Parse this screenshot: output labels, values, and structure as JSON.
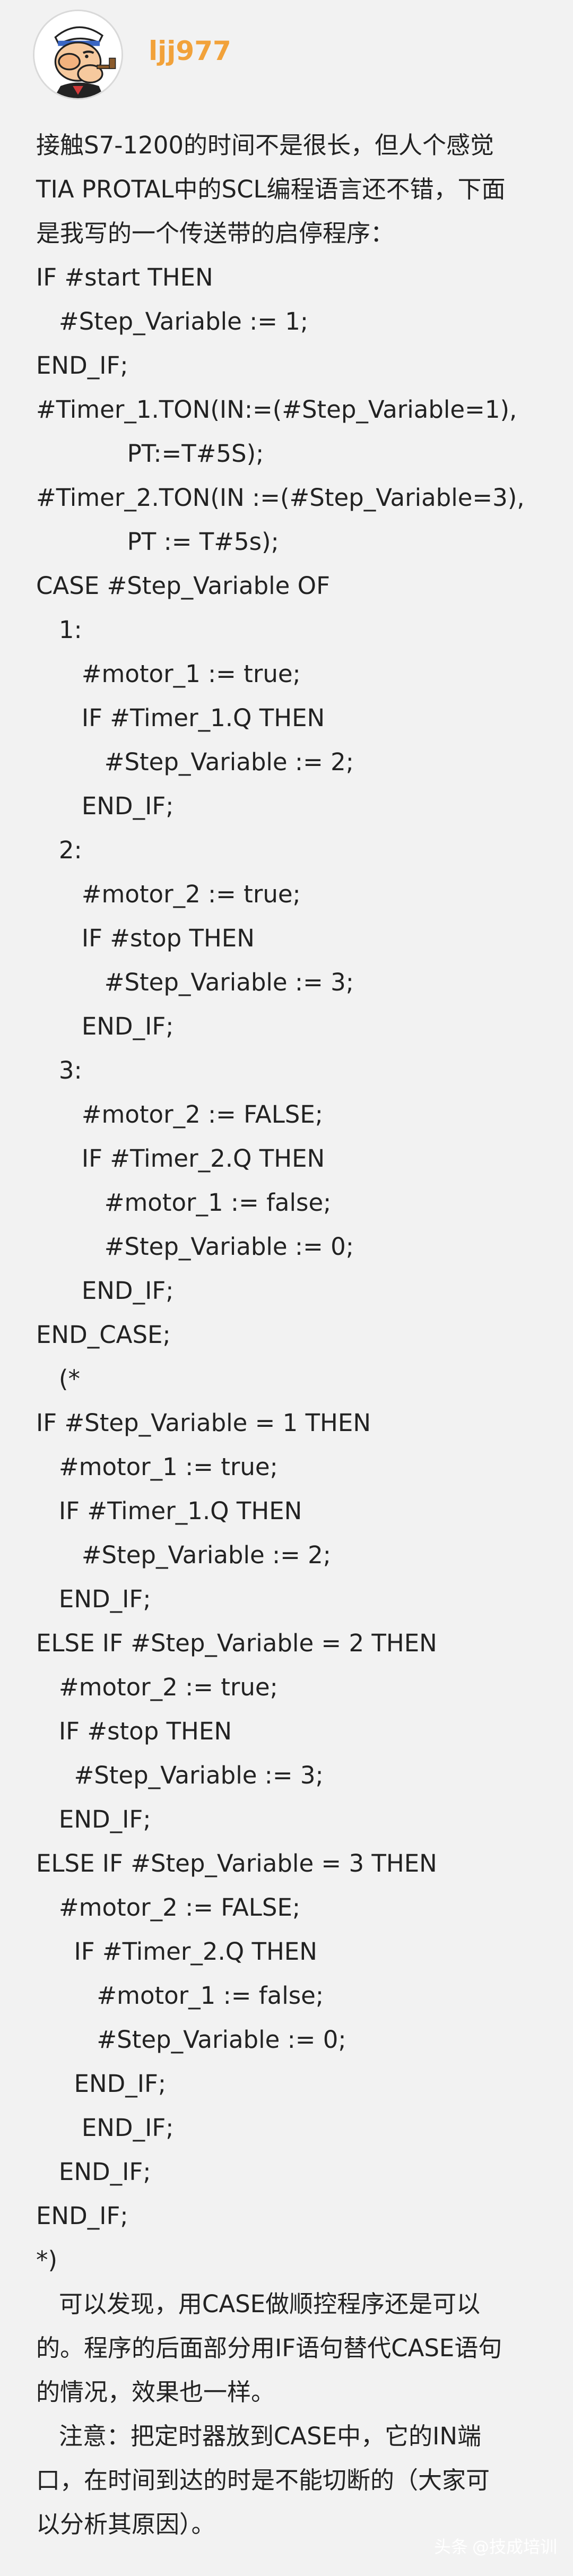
{
  "author": {
    "username": "ljj977",
    "avatar_icon": "popeye-avatar-icon"
  },
  "colors": {
    "background": "#f2f2f2",
    "username": "#f2a23a",
    "text": "#222222"
  },
  "content": {
    "lines": [
      "接触S7-1200的时间不是很长，但人个感觉",
      "TIA PROTAL中的SCL编程语言还不错，下面",
      "是我写的一个传送带的启停程序：",
      "IF #start THEN",
      "   #Step_Variable := 1;",
      "END_IF;",
      "#Timer_1.TON(IN:=(#Step_Variable=1),",
      "            PT:=T#5S);",
      "#Timer_2.TON(IN :=(#Step_Variable=3),",
      "            PT := T#5s);",
      "CASE #Step_Variable OF",
      "   1:",
      "      #motor_1 := true;",
      "      IF #Timer_1.Q THEN",
      "         #Step_Variable := 2;",
      "      END_IF;",
      "   2:",
      "      #motor_2 := true;",
      "      IF #stop THEN",
      "         #Step_Variable := 3;",
      "      END_IF;",
      "   3:",
      "      #motor_2 := FALSE;",
      "      IF #Timer_2.Q THEN",
      "         #motor_1 := false;",
      "         #Step_Variable := 0;",
      "      END_IF;",
      "END_CASE;",
      "   (*",
      "IF #Step_Variable = 1 THEN",
      "   #motor_1 := true;",
      "   IF #Timer_1.Q THEN",
      "      #Step_Variable := 2;",
      "   END_IF;",
      "ELSE IF #Step_Variable = 2 THEN",
      "   #motor_2 := true;",
      "   IF #stop THEN",
      "     #Step_Variable := 3;",
      "   END_IF;",
      "ELSE IF #Step_Variable = 3 THEN",
      "   #motor_2 := FALSE;",
      "     IF #Timer_2.Q THEN",
      "        #motor_1 := false;",
      "        #Step_Variable := 0;",
      "     END_IF;",
      "      END_IF;",
      "   END_IF;",
      "END_IF;",
      "*)",
      "   可以发现，用CASE做顺控程序还是可以",
      "的。程序的后面部分用IF语句替代CASE语句",
      "的情况，效果也一样。",
      "   注意：把定时器放到CASE中，它的IN端",
      "口，在时间到达的时是不能切断的（大家可",
      "以分析其原因）。"
    ]
  },
  "watermark": {
    "source": "头条",
    "account": "@技成培训"
  }
}
